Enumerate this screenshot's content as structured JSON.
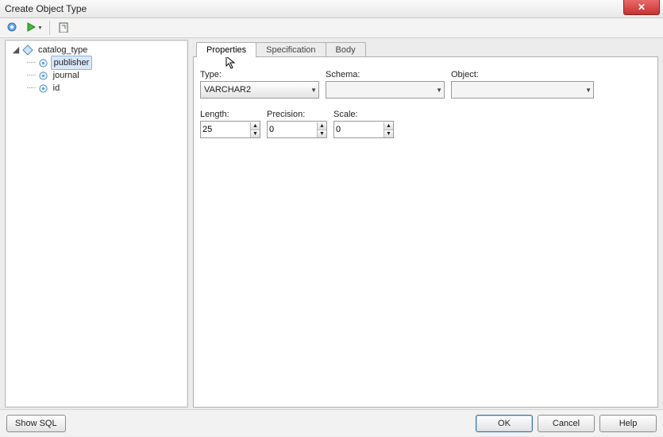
{
  "window": {
    "title": "Create Object Type"
  },
  "tree": {
    "root": "catalog_type",
    "children": [
      {
        "label": "publisher",
        "selected": true
      },
      {
        "label": "journal",
        "selected": false
      },
      {
        "label": "id",
        "selected": false
      }
    ]
  },
  "tabs": {
    "properties": "Properties",
    "specification": "Specification",
    "body": "Body",
    "active": "properties"
  },
  "form": {
    "type_label": "Type:",
    "type_value": "VARCHAR2",
    "schema_label": "Schema:",
    "schema_value": "",
    "object_label": "Object:",
    "object_value": "",
    "length_label": "Length:",
    "length_value": "25",
    "precision_label": "Precision:",
    "precision_value": "0",
    "scale_label": "Scale:",
    "scale_value": "0"
  },
  "buttons": {
    "show_sql": "Show SQL",
    "ok": "OK",
    "cancel": "Cancel",
    "help": "Help"
  },
  "icons": {
    "close": "✕",
    "combo_arrow": "▼",
    "spin_up": "▲",
    "spin_down": "▼"
  }
}
